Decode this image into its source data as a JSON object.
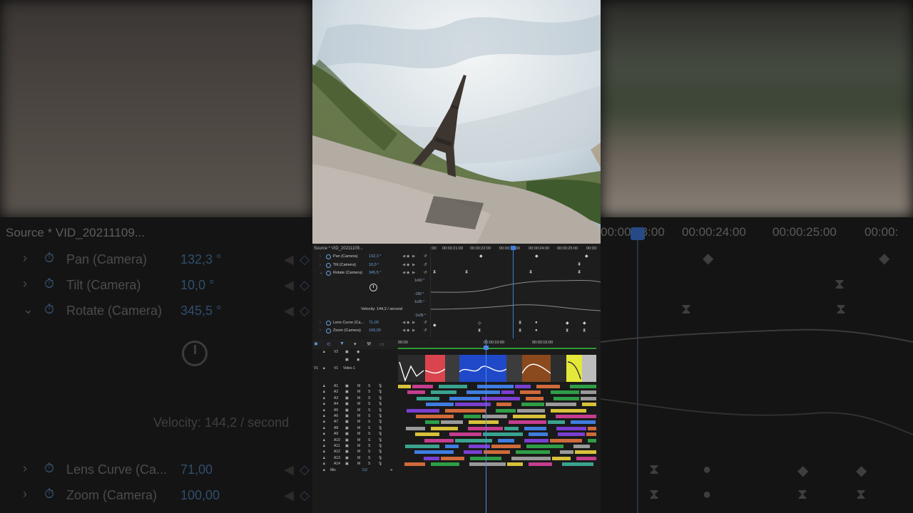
{
  "source_panel": {
    "title": "Source * VID_20211109...",
    "big_title": "Source * VID_20211109...",
    "params": [
      {
        "name": "Pan (Camera)",
        "value": "132,3 °",
        "expanded": false
      },
      {
        "name": "Tilt (Camera)",
        "value": "10,0 °",
        "expanded": false
      },
      {
        "name": "Rotate (Camera)",
        "value": "345,5 °",
        "expanded": true
      },
      {
        "name": "Lens Curve (Ca...",
        "value": "71,00",
        "expanded": false
      },
      {
        "name": "Zoom (Camera)",
        "value": "100,00",
        "expanded": false
      }
    ],
    "velocity": "Velocity: 144,2 / second",
    "graph_labels": [
      "1x60 °",
      "-100 °",
      "1x35 °",
      "-1x35 °"
    ],
    "reset_icon": "reset-icon",
    "keyframe_nav": [
      "◀",
      "◆",
      "▶"
    ]
  },
  "keyframe_timeline": {
    "times": [
      ":00",
      "00:00:21:00",
      "00:00:22:00",
      "00:00:23:00",
      "00:00:24:00",
      "00:00:25:00",
      "00:00:"
    ]
  },
  "big_right_times": [
    "00:00:23:00",
    "00:00:24:00",
    "00:00:25:00",
    "00:00:"
  ],
  "timeline": {
    "ruler": [
      "00:00",
      "00:00:10:00",
      "00:00:15:00"
    ],
    "video_tracks": [
      {
        "id": "V2",
        "name": ""
      },
      {
        "id": "V1",
        "name": "Video 1"
      }
    ],
    "audio_tracks": [
      "A1",
      "A2",
      "A3",
      "A4",
      "A5",
      "A6",
      "A7",
      "A8",
      "A9",
      "A10",
      "A11",
      "A12",
      "A13",
      "A14"
    ],
    "mix_label": "Mix",
    "mix_value": "0,0",
    "mute_label": "M",
    "solo_label": "S"
  },
  "colors": {
    "accent": "#3f7de0",
    "panel": "#1d1d1d",
    "value_blue": "#6aa0e0"
  }
}
